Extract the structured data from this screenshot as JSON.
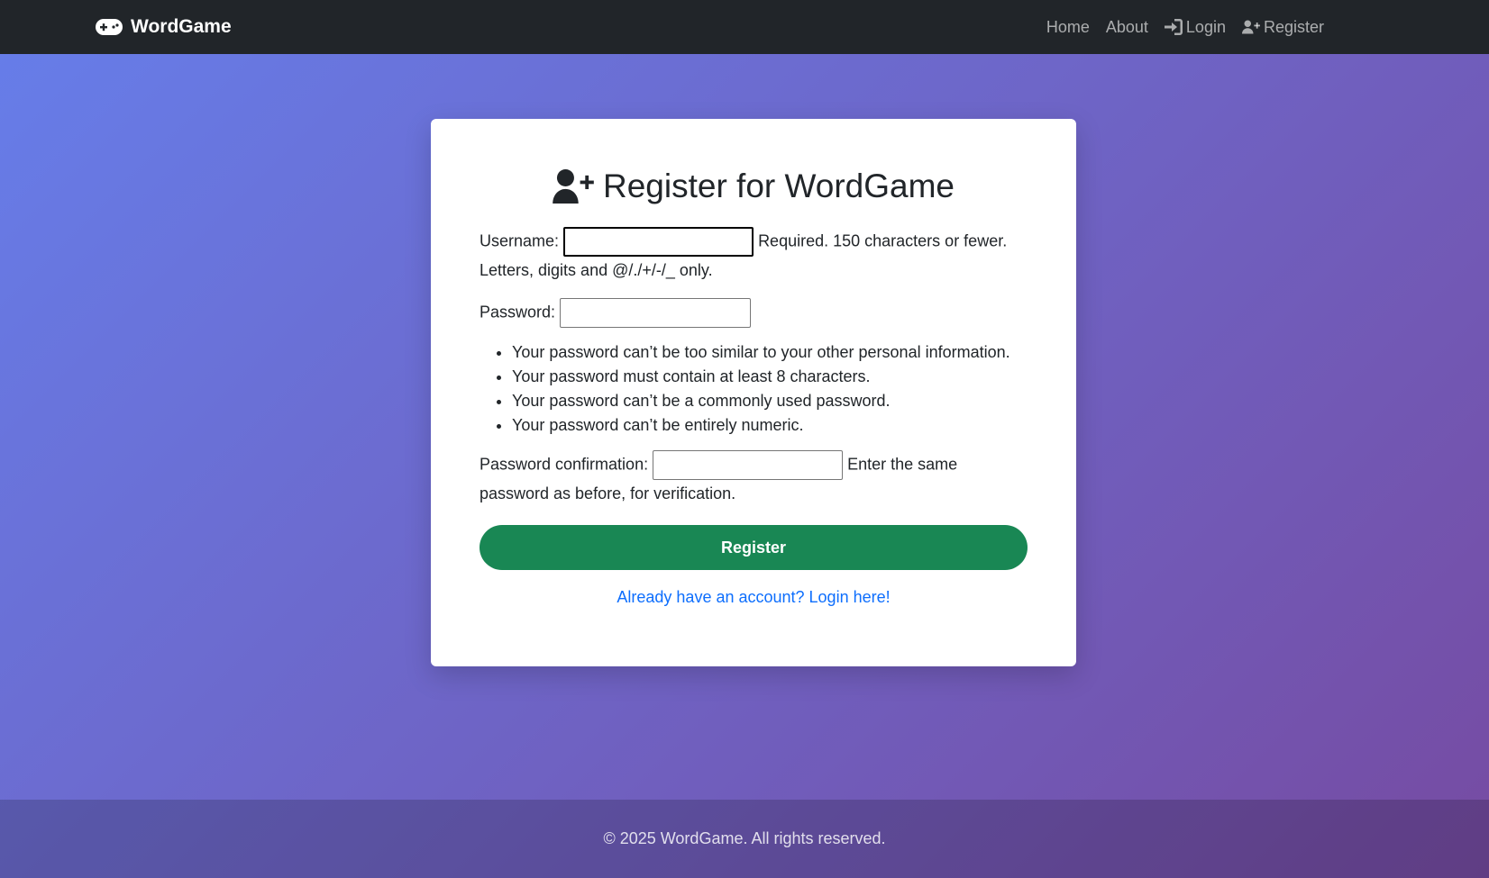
{
  "navbar": {
    "brand": "WordGame",
    "links": [
      {
        "label": "Home",
        "icon": null
      },
      {
        "label": "About",
        "icon": null
      },
      {
        "label": "Login",
        "icon": "login-icon"
      },
      {
        "label": "Register",
        "icon": "user-plus-icon"
      }
    ]
  },
  "card": {
    "title": "Register for WordGame",
    "username": {
      "label": "Username:",
      "value": "",
      "help": "Required. 150 characters or fewer. Letters, digits and @/./+/-/_ only."
    },
    "password": {
      "label": "Password:",
      "value": "",
      "hints": [
        "Your password can’t be too similar to your other personal information.",
        "Your password must contain at least 8 characters.",
        "Your password can’t be a commonly used password.",
        "Your password can’t be entirely numeric."
      ]
    },
    "password_confirmation": {
      "label": "Password confirmation:",
      "value": "",
      "help": "Enter the same password as before, for verification."
    },
    "submit_label": "Register",
    "login_link": "Already have an account? Login here!"
  },
  "footer": {
    "text": "© 2025 WordGame. All rights reserved."
  },
  "colors": {
    "navbar_bg": "#212529",
    "gradient_start": "#667eea",
    "gradient_end": "#764ba2",
    "button_green": "#198754",
    "link_blue": "#0d6efd"
  }
}
